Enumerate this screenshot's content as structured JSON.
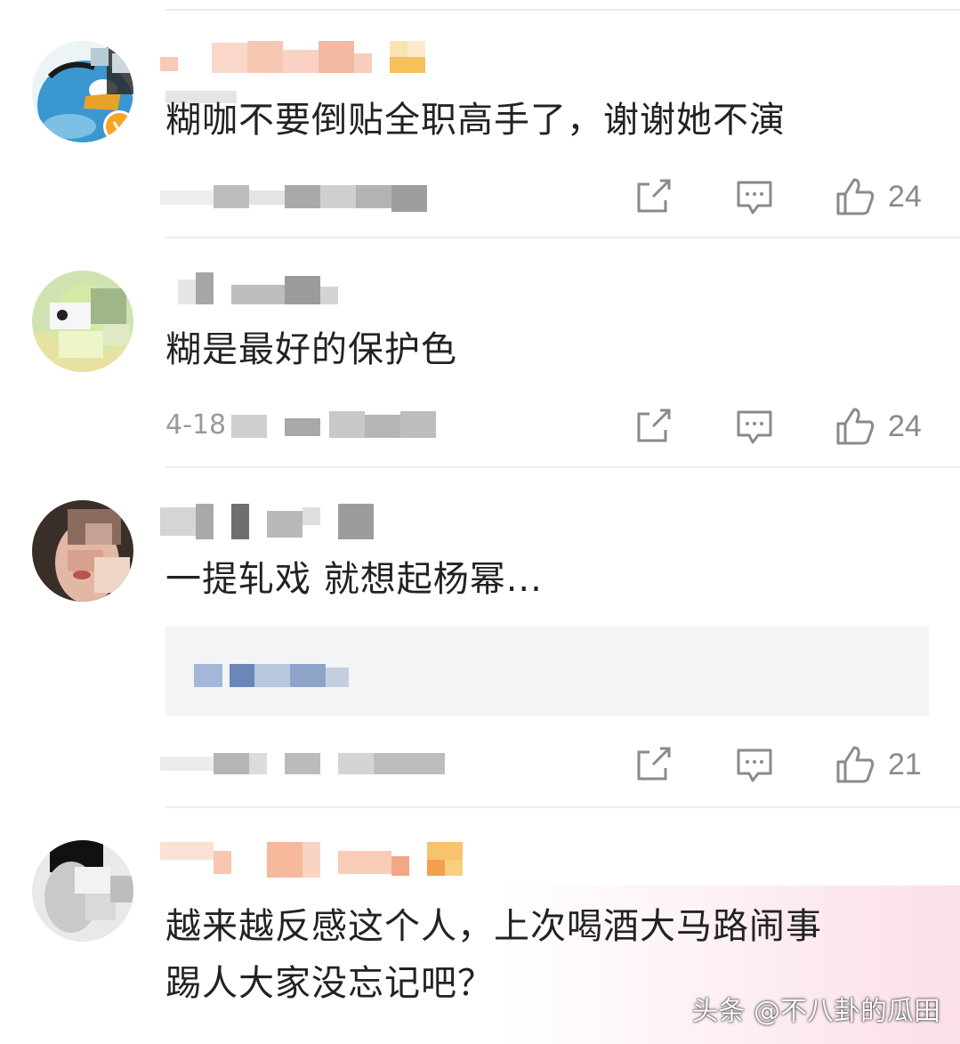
{
  "comments": [
    {
      "text": "糊咖不要倒贴全职高手了，谢谢她不演",
      "likes": "24"
    },
    {
      "text": "糊是最好的保护色",
      "meta_prefix": "4-18",
      "likes": "24"
    },
    {
      "text": "一提轧戏 就想起杨幂...",
      "likes": "21"
    },
    {
      "text_line1": "越来越反感这个人，上次喝酒大马路闹事",
      "text_line2": "踢人大家没忘记吧？"
    }
  ],
  "icons": {
    "share": "share-icon",
    "comment": "comment-icon",
    "like": "thumbs-up-icon",
    "verified": "verified-badge-icon"
  },
  "colors": {
    "verified_badge": "#f5a623",
    "icon_gray": "#8a8a8a",
    "reply_bg": "#f4f4f6",
    "divider": "#ededed"
  },
  "watermark": "头条 @不八卦的瓜田"
}
